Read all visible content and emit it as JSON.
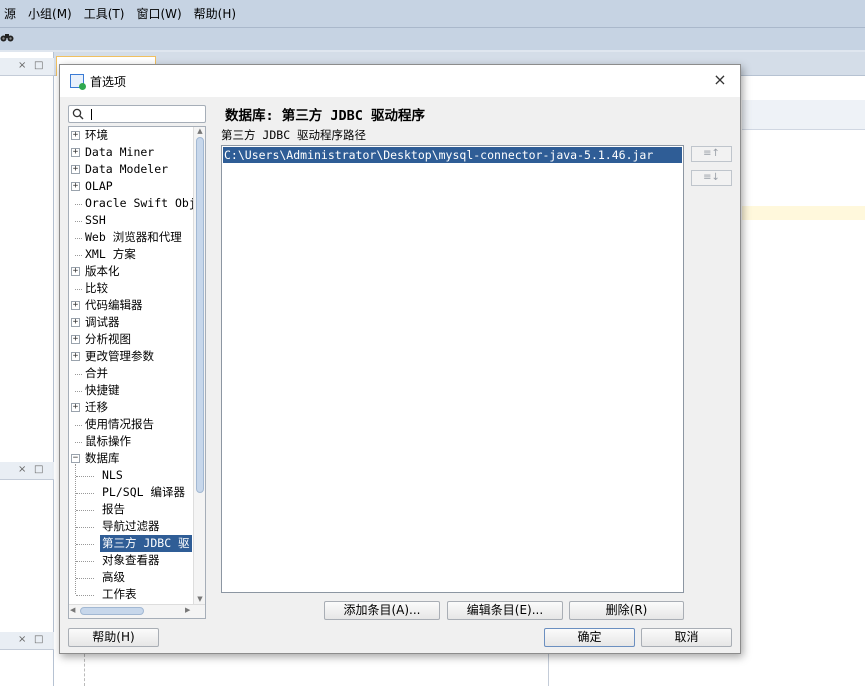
{
  "menubar": {
    "items": [
      "源",
      "小组(M)",
      "工具(T)",
      "窗口(W)",
      "帮助(H)"
    ]
  },
  "background": {
    "panel_controls": [
      "×",
      "□"
    ]
  },
  "dialog": {
    "title": "首选项",
    "close_symbol": "×"
  },
  "search": {
    "value": "",
    "placeholder": ""
  },
  "tree": {
    "items": [
      {
        "label": "环境",
        "level": 0,
        "expander": "+"
      },
      {
        "label": "Data Miner",
        "level": 0,
        "expander": "+"
      },
      {
        "label": "Data Modeler",
        "level": 0,
        "expander": "+"
      },
      {
        "label": "OLAP",
        "level": 0,
        "expander": "+"
      },
      {
        "label": "Oracle Swift Obj",
        "level": 0,
        "expander": ""
      },
      {
        "label": "SSH",
        "level": 0,
        "expander": ""
      },
      {
        "label": "Web 浏览器和代理",
        "level": 0,
        "expander": ""
      },
      {
        "label": "XML 方案",
        "level": 0,
        "expander": ""
      },
      {
        "label": "版本化",
        "level": 0,
        "expander": "+"
      },
      {
        "label": "比较",
        "level": 0,
        "expander": ""
      },
      {
        "label": "代码编辑器",
        "level": 0,
        "expander": "+"
      },
      {
        "label": "调试器",
        "level": 0,
        "expander": "+"
      },
      {
        "label": "分析视图",
        "level": 0,
        "expander": "+"
      },
      {
        "label": "更改管理参数",
        "level": 0,
        "expander": "+"
      },
      {
        "label": "合并",
        "level": 0,
        "expander": ""
      },
      {
        "label": "快捷键",
        "level": 0,
        "expander": ""
      },
      {
        "label": "迁移",
        "level": 0,
        "expander": "+"
      },
      {
        "label": "使用情况报告",
        "level": 0,
        "expander": ""
      },
      {
        "label": "鼠标操作",
        "level": 0,
        "expander": ""
      },
      {
        "label": "数据库",
        "level": 0,
        "expander": "−"
      },
      {
        "label": "NLS",
        "level": 1,
        "expander": ""
      },
      {
        "label": "PL/SQL 编译器",
        "level": 1,
        "expander": ""
      },
      {
        "label": "报告",
        "level": 1,
        "expander": ""
      },
      {
        "label": "导航过滤器",
        "level": 1,
        "expander": ""
      },
      {
        "label": "第三方 JDBC 驱",
        "level": 1,
        "expander": "",
        "selected": true
      },
      {
        "label": "对象查看器",
        "level": 1,
        "expander": ""
      },
      {
        "label": "高级",
        "level": 1,
        "expander": ""
      },
      {
        "label": "工作表",
        "level": 1,
        "expander": ""
      }
    ]
  },
  "scroll": {
    "up": "▲",
    "down": "▼",
    "left": "◀",
    "right": "▶"
  },
  "content": {
    "title": "数据库: 第三方 JDBC 驱动程序",
    "path_label": "第三方 JDBC 驱动程序路径",
    "paths": [
      "C:\\Users\\Administrator\\Desktop\\mysql-connector-java-5.1.46.jar"
    ],
    "move_up_symbol": "≡↑",
    "move_down_symbol": "≡↓"
  },
  "buttons": {
    "add": "添加条目(A)...",
    "edit": "编辑条目(E)...",
    "delete": "删除(R)",
    "help": "帮助(H)",
    "ok": "确定",
    "cancel": "取消"
  },
  "colors": {
    "selection": "#2f5d96",
    "menubar": "#c6d3e3"
  }
}
